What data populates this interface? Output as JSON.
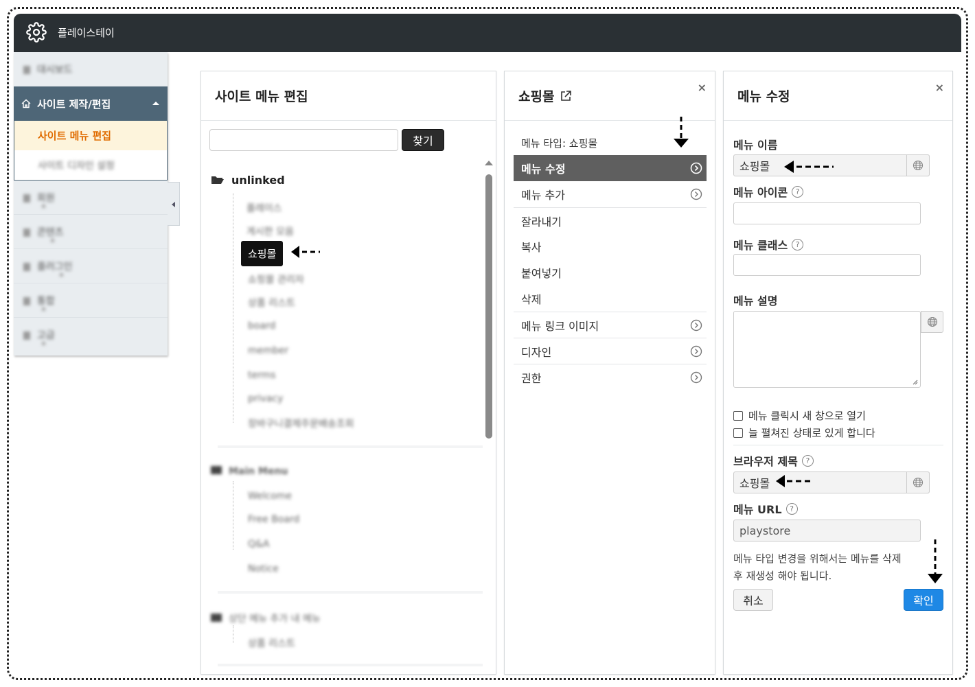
{
  "app": {
    "title": "플레이스테이"
  },
  "sidebar": {
    "items_top": [
      {
        "label": "대시보드"
      }
    ],
    "active_section": {
      "label": "사이트 제작/편집"
    },
    "sub_items": [
      {
        "label": "사이트 메뉴 편집",
        "active": true
      },
      {
        "label": "사이트 디자인 설정",
        "active": false
      }
    ],
    "items_bottom": [
      {
        "label": "회원"
      },
      {
        "label": "콘텐츠"
      },
      {
        "label": "플러그인"
      },
      {
        "label": "통합"
      },
      {
        "label": "고급"
      }
    ]
  },
  "tree_panel": {
    "title": "사이트 메뉴 편집",
    "search_button": "찾기",
    "root_label": "unlinked",
    "selected_node": "쇼핑몰",
    "blurred_nodes_1": [
      "플레이스",
      "게시판 모음",
      "쇼핑몰 관리자",
      "상품 리스트",
      "board",
      "member",
      "terms",
      "privacy",
      "장바구니결제주문배송조회"
    ],
    "group2_label": "Main Menu",
    "group2_nodes": [
      "Welcome",
      "Free Board",
      "Q&A",
      "Notice"
    ],
    "group3_label": "상단 메뉴 추가 내 메뉴",
    "group3_nodes": [
      "상품 리스트"
    ]
  },
  "action_panel": {
    "title": "쇼핑몰",
    "type_line": "메뉴 타입: 쇼핑몰",
    "items": [
      {
        "label": "메뉴 수정",
        "active": true,
        "arrow": true
      },
      {
        "label": "메뉴 추가",
        "active": false,
        "arrow": true
      },
      {
        "label": "잘라내기",
        "active": false,
        "arrow": false
      },
      {
        "label": "복사",
        "active": false,
        "arrow": false
      },
      {
        "label": "붙여넣기",
        "active": false,
        "arrow": false
      },
      {
        "label": "삭제",
        "active": false,
        "arrow": false
      },
      {
        "label": "메뉴 링크 이미지",
        "active": false,
        "arrow": true
      },
      {
        "label": "디자인",
        "active": false,
        "arrow": true
      },
      {
        "label": "권한",
        "active": false,
        "arrow": true
      }
    ]
  },
  "edit_panel": {
    "title": "메뉴 수정",
    "name_label": "메뉴 이름",
    "name_value": "쇼핑몰",
    "icon_label": "메뉴 아이콘",
    "class_label": "메뉴 클래스",
    "desc_label": "메뉴 설명",
    "check_new_window": "메뉴 클릭시 새 창으로 열기",
    "check_expanded": "늘 펼쳐진 상태로 있게 합니다",
    "browser_title_label": "브라우저 제목",
    "browser_title_value": "쇼핑몰",
    "url_label": "메뉴 URL",
    "url_value": "playstore",
    "note_line1": "메뉴 타입 변경을 위해서는 메뉴를 삭제",
    "note_line2": "후 재생성 해야 됩니다.",
    "cancel_button": "취소",
    "ok_button": "확인"
  },
  "colors": {
    "topbar": "#2a3034",
    "sidebar_active": "#4e6677",
    "sub_active_text": "#e06b00",
    "ok_button": "#1e88e5"
  }
}
